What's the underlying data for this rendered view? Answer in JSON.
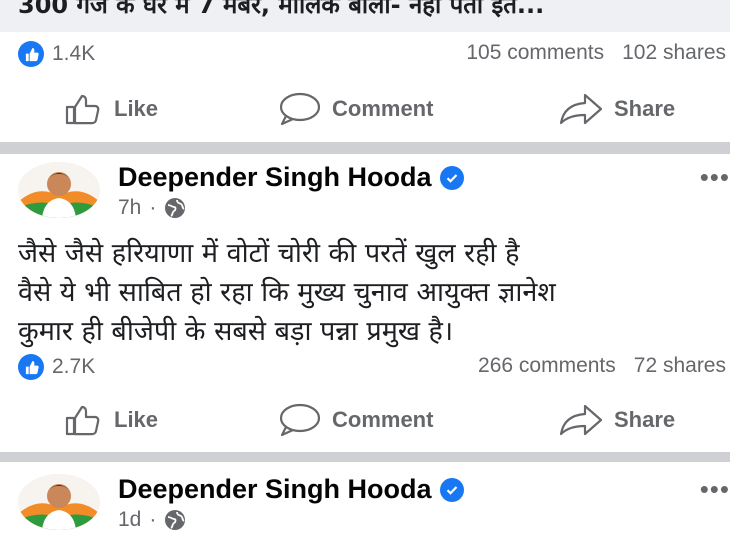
{
  "previous_post": {
    "headline": "300 गज के घर में 7 मेंबर, मालिक बोली- नहीं पता इत...",
    "reactions_count": "1.4K",
    "comments": "105 comments",
    "shares": "102 shares"
  },
  "actions": {
    "like": "Like",
    "comment": "Comment",
    "share": "Share"
  },
  "post": {
    "author": "Deepender Singh Hooda",
    "time": "7h",
    "separator": "·",
    "lines": [
      "जैसे जैसे हरियाणा में वोटों चोरी की परतें खुल रही है",
      "वैसे ये भी साबित हो रहा कि मुख्य चुनाव आयुक्त ज्ञानेश",
      "कुमार ही बीजेपी के सबसे बड़ा पन्ना प्रमुख है।"
    ],
    "reactions_count": "2.7K",
    "comments": "266 comments",
    "shares": "72 shares",
    "more": "•••"
  },
  "next_post": {
    "author": "Deepender Singh Hooda",
    "time": "1d",
    "separator": "·",
    "more": "•••"
  },
  "colors": {
    "accent": "#1877f2",
    "muted_text": "#65676b",
    "divider": "#ced0d4"
  },
  "icons": {
    "reaction": "like-icon",
    "like": "thumbs-up-outline-icon",
    "comment": "comment-bubble-icon",
    "share": "share-arrow-icon",
    "audience": "globe-icon",
    "verified": "verified-badge-icon"
  }
}
